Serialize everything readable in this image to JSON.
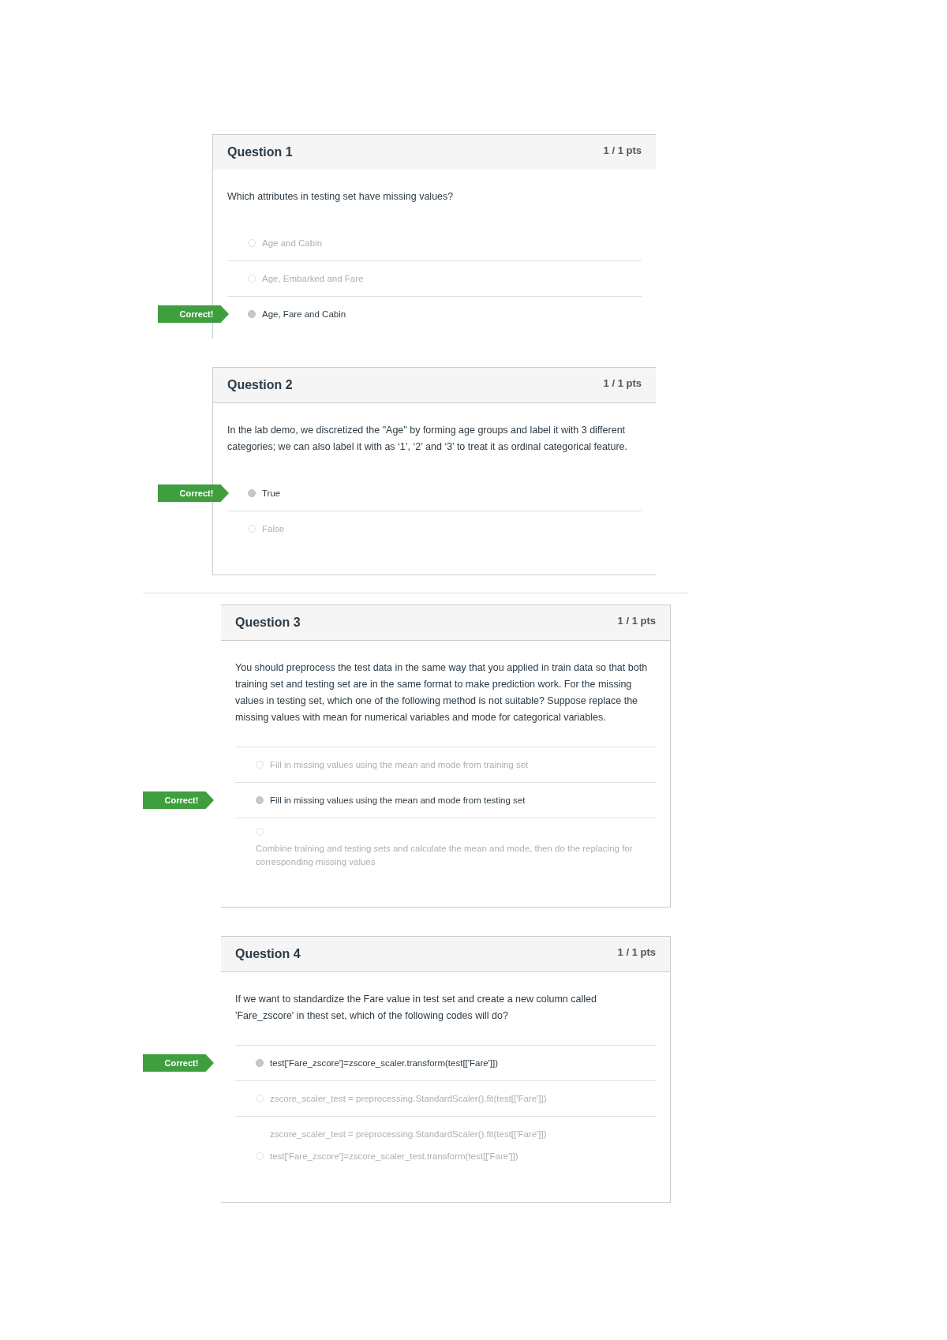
{
  "questions": [
    {
      "title": "Question 1",
      "points": "1 / 1 pts",
      "text": "Which attributes in testing set have missing values?",
      "options": [
        {
          "kind": "inline",
          "lines": [
            "Age and Cabin"
          ],
          "selected": false
        },
        {
          "kind": "inline",
          "lines": [
            "Age, Embarked and Fare"
          ],
          "selected": false
        },
        {
          "kind": "inline",
          "lines": [
            "Age, Fare and Cabin"
          ],
          "selected": true,
          "flag": "Correct!"
        }
      ]
    },
    {
      "title": "Question 2",
      "points": "1 / 1 pts",
      "text": "In the lab demo, we discretized the \"Age\" by forming age groups and label it with 3 different categories; we can also label it with as ‘1’, ‘2’ and ‘3’ to treat it as ordinal categorical feature.",
      "options": [
        {
          "kind": "inline",
          "lines": [
            "True"
          ],
          "selected": true,
          "flag": "Correct!"
        },
        {
          "kind": "inline",
          "lines": [
            "False"
          ],
          "selected": false
        }
      ]
    },
    {
      "title": "Question 3",
      "points": "1 / 1 pts",
      "text": "You should preprocess the test data in the same way that you applied in train data so that both training set and testing set are in the same format to make prediction work. For the missing values in testing set, which one of the following method is not suitable? Suppose replace the missing values with mean for numerical variables and mode for categorical variables.",
      "options": [
        {
          "kind": "inline",
          "lines": [
            "Fill in missing values using the mean and mode from training set"
          ],
          "selected": false
        },
        {
          "kind": "inline",
          "lines": [
            "Fill in missing values using the mean and mode from testing set"
          ],
          "selected": true,
          "flag": "Correct!"
        },
        {
          "kind": "stacked",
          "lines": [
            "Combine training and testing sets and calculate the mean and mode, then do the replacing for corresponding missing values"
          ],
          "selected": false
        }
      ]
    },
    {
      "title": "Question 4",
      "points": "1 / 1 pts",
      "text": "If we want to standardize the Fare value in test set and create a new column called 'Fare_zscore' in thest set, which of the following codes will do?",
      "options": [
        {
          "kind": "inline",
          "lines": [
            "test['Fare_zscore']=zscore_scaler.transform(test[['Fare']])"
          ],
          "selected": true,
          "flag": "Correct!"
        },
        {
          "kind": "inline",
          "lines": [
            "zscore_scaler_test = preprocessing.StandardScaler().fit(test[['Fare']])"
          ],
          "selected": false
        },
        {
          "kind": "inline",
          "lines": [
            "zscore_scaler_test = preprocessing.StandardScaler().fit(test[['Fare']])",
            "test['Fare_zscore']=zscore_scaler_test.transform(test[['Fare']])"
          ],
          "selected": false
        }
      ]
    }
  ]
}
